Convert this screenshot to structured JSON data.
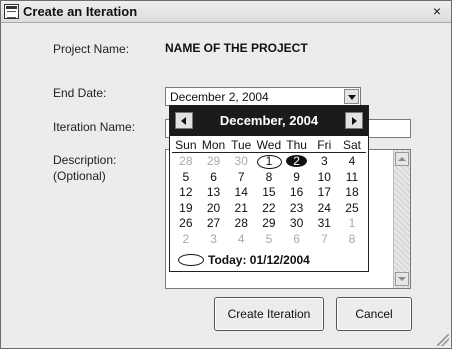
{
  "window": {
    "title": "Create an Iteration",
    "close_label": "×"
  },
  "form": {
    "project_name_label": "Project Name:",
    "project_name_value": "NAME OF THE PROJECT",
    "end_date_label": "End Date:",
    "end_date_value": "December  2, 2004",
    "iteration_name_label": "Iteration Name:",
    "description_label": "Description:",
    "description_optional": "(Optional)"
  },
  "calendar": {
    "month_label": "December, 2004",
    "days_of_week": [
      "Sun",
      "Mon",
      "Tue",
      "Wed",
      "Thu",
      "Fri",
      "Sat"
    ],
    "weeks": [
      [
        "28",
        "29",
        "30",
        "1",
        "2",
        "3",
        "4"
      ],
      [
        "5",
        "6",
        "7",
        "8",
        "9",
        "10",
        "11"
      ],
      [
        "12",
        "13",
        "14",
        "15",
        "16",
        "17",
        "18"
      ],
      [
        "19",
        "20",
        "21",
        "22",
        "23",
        "24",
        "25"
      ],
      [
        "26",
        "27",
        "28",
        "29",
        "30",
        "31",
        "1"
      ],
      [
        "2",
        "3",
        "4",
        "5",
        "6",
        "7",
        "8"
      ]
    ],
    "today_label": "Today: 01/12/2004"
  },
  "buttons": {
    "create": "Create Iteration",
    "cancel": "Cancel"
  },
  "icons": {
    "app": "window-icon",
    "close": "close-icon",
    "dropdown": "chevron-down-icon",
    "prev": "arrow-left-icon",
    "next": "arrow-right-icon"
  }
}
